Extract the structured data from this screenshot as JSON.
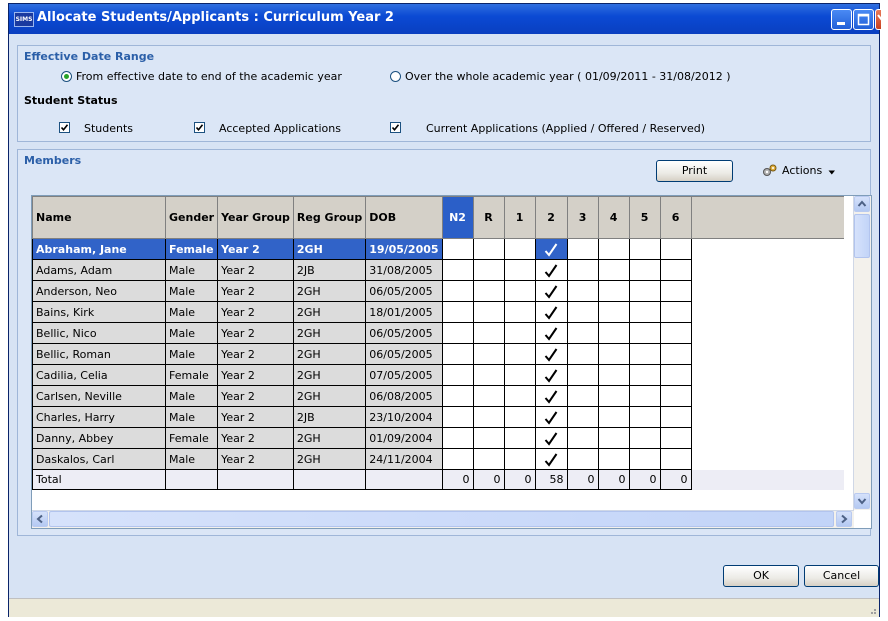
{
  "window": {
    "title": "Allocate Students/Applicants : Curriculum Year  2",
    "app_icon_text": "SIMS"
  },
  "effective_date": {
    "group_title": "Effective Date Range",
    "option1_label": "From effective date to end of the academic year",
    "option1_selected": true,
    "option2_label": "Over the whole academic year ( 01/09/2011 - 31/08/2012 )",
    "option2_selected": false
  },
  "student_status": {
    "title": "Student Status",
    "students_label": "Students",
    "accepted_label": "Accepted Applications",
    "current_label": "Current Applications (Applied / Offered / Reserved)",
    "students_checked": true,
    "accepted_checked": true,
    "current_checked": true
  },
  "members": {
    "title": "Members",
    "print_label": "Print",
    "actions_label": "Actions",
    "columns": [
      "Name",
      "Gender",
      "Year Group",
      "Reg Group",
      "DOB"
    ],
    "year_columns": [
      "N2",
      "R",
      "1",
      "2",
      "3",
      "4",
      "5",
      "6"
    ],
    "rows": [
      {
        "name": "Abraham, Jane",
        "gender": "Female",
        "year_group": "Year  2",
        "reg_group": "2GH",
        "dob": "19/05/2005",
        "selected": true
      },
      {
        "name": "Adams, Adam",
        "gender": "Male",
        "year_group": "Year  2",
        "reg_group": "2JB",
        "dob": "31/08/2005"
      },
      {
        "name": "Anderson, Neo",
        "gender": "Male",
        "year_group": "Year  2",
        "reg_group": "2GH",
        "dob": "06/05/2005"
      },
      {
        "name": "Bains, Kirk",
        "gender": "Male",
        "year_group": "Year  2",
        "reg_group": "2GH",
        "dob": "18/01/2005"
      },
      {
        "name": "Bellic, Nico",
        "gender": "Male",
        "year_group": "Year  2",
        "reg_group": "2GH",
        "dob": "06/05/2005"
      },
      {
        "name": "Bellic, Roman",
        "gender": "Male",
        "year_group": "Year  2",
        "reg_group": "2GH",
        "dob": "06/05/2005"
      },
      {
        "name": "Cadilia, Celia",
        "gender": "Female",
        "year_group": "Year  2",
        "reg_group": "2GH",
        "dob": "07/05/2005"
      },
      {
        "name": "Carlsen, Neville",
        "gender": "Male",
        "year_group": "Year  2",
        "reg_group": "2GH",
        "dob": "06/08/2005"
      },
      {
        "name": "Charles, Harry",
        "gender": "Male",
        "year_group": "Year  2",
        "reg_group": "2JB",
        "dob": "23/10/2004"
      },
      {
        "name": "Danny, Abbey",
        "gender": "Female",
        "year_group": "Year  2",
        "reg_group": "2GH",
        "dob": "01/09/2004"
      },
      {
        "name": "Daskalos, Carl",
        "gender": "Male",
        "year_group": "Year  2",
        "reg_group": "2GH",
        "dob": "24/11/2004"
      }
    ],
    "allocated_year_column": "2",
    "total_label": "Total",
    "totals": [
      "0",
      "0",
      "0",
      "58",
      "0",
      "0",
      "0",
      "0"
    ]
  },
  "buttons": {
    "ok_label": "OK",
    "cancel_label": "Cancel"
  },
  "colors": {
    "selection": "#3163c8",
    "title_bar": "#0b4ad4",
    "group_title": "#2b5fa8"
  }
}
